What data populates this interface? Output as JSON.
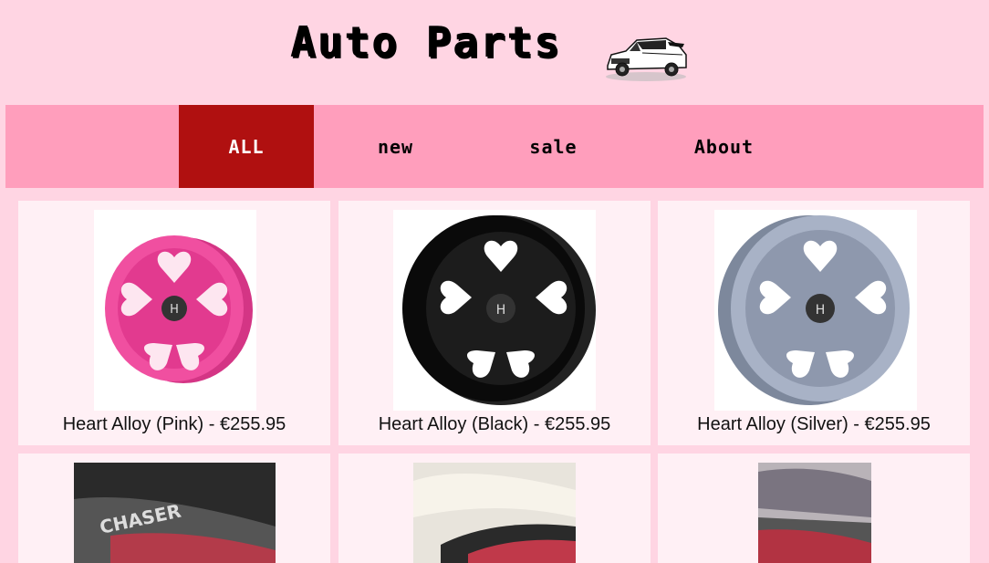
{
  "header": {
    "title": "Auto Parts",
    "logo_icon": "car-icon"
  },
  "nav": {
    "items": [
      {
        "label": "ALL",
        "active": true
      },
      {
        "label": "new",
        "active": false
      },
      {
        "label": "sale",
        "active": false
      },
      {
        "label": "About",
        "active": false
      }
    ]
  },
  "products": [
    {
      "caption": "Heart Alloy (Pink) - €255.95",
      "color": "#f0409a",
      "icon": "wheel-icon"
    },
    {
      "caption": "Heart Alloy (Black) - €255.95",
      "color": "#111111",
      "icon": "wheel-icon"
    },
    {
      "caption": "Heart Alloy (Silver) - €255.95",
      "color": "#9aa4b8",
      "icon": "wheel-icon"
    },
    {
      "caption": "CHASER",
      "icon": "taillight-photo"
    },
    {
      "caption": "",
      "icon": "taillight-photo"
    },
    {
      "caption": "",
      "icon": "taillight-photo"
    }
  ],
  "colors": {
    "background": "#ffd5e3",
    "navbar": "#ff9ebc",
    "nav_active": "#b01010",
    "card": "#fff0f5"
  }
}
